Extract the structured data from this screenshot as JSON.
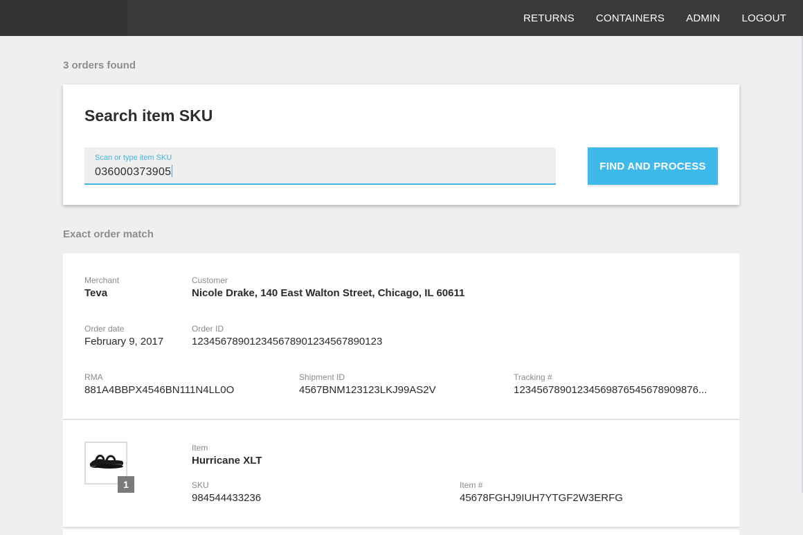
{
  "nav": {
    "items": [
      "RETURNS",
      "CONTAINERS",
      "ADMIN",
      "LOGOUT"
    ]
  },
  "results": {
    "count_text": "3 orders found"
  },
  "search": {
    "title": "Search item SKU",
    "field_label": "Scan or type item SKU",
    "value": "036000373905",
    "button_label": "FIND AND PROCESS"
  },
  "section": {
    "label": "Exact order match"
  },
  "order": {
    "merchant_label": "Merchant",
    "merchant": "Teva",
    "customer_label": "Customer",
    "customer": "Nicole Drake, 140 East Walton Street, Chicago, IL 60611",
    "order_date_label": "Order date",
    "order_date": "February 9, 2017",
    "order_id_label": "Order ID",
    "order_id": "123456789012345678901234567890123",
    "rma_label": "RMA",
    "rma": "881A4BBPX4546BN111N4LL0O",
    "shipment_id_label": "Shipment ID",
    "shipment_id": "4567BNM123123LKJ99AS2V",
    "tracking_label": "Tracking #",
    "tracking": "12345678901234569876545678909876..."
  },
  "item": {
    "qty": "1",
    "item_label": "Item",
    "name": "Hurricane XLT",
    "sku_label": "SKU",
    "sku": "984544433236",
    "item_no_label": "Item #",
    "item_no": "45678FGHJ9IUH7YTGF2W3ERFG",
    "thumbnail_icon": "sandal-icon"
  },
  "colors": {
    "topbar": "#3a3a3a",
    "accent": "#3fb9ea",
    "background": "#efefef"
  }
}
